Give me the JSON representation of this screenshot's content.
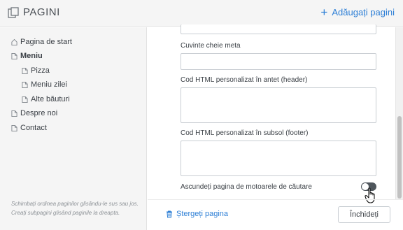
{
  "header": {
    "title": "PAGINI",
    "add_label": "Adăugați pagini",
    "icon": "pages-icon"
  },
  "sidebar": {
    "items": [
      {
        "label": "Pagina de start",
        "icon": "home-icon",
        "level": 0,
        "bold": false
      },
      {
        "label": "Meniu",
        "icon": "page-icon",
        "level": 0,
        "bold": true
      },
      {
        "label": "Pizza",
        "icon": "page-icon",
        "level": 1,
        "bold": false
      },
      {
        "label": "Meniu zilei",
        "icon": "page-icon",
        "level": 1,
        "bold": false
      },
      {
        "label": "Alte băuturi",
        "icon": "page-icon",
        "level": 1,
        "bold": false
      },
      {
        "label": "Despre noi",
        "icon": "page-icon",
        "level": 0,
        "bold": false
      },
      {
        "label": "Contact",
        "icon": "page-icon",
        "level": 0,
        "bold": false
      }
    ],
    "hint": "Schimbați ordinea paginilor glisându-le sus sau jos. Creați subpagini glisând paginile la dreapta."
  },
  "form": {
    "meta_keywords_label": "Cuvinte cheie meta",
    "header_html_label": "Cod HTML personalizat în antet (header)",
    "footer_html_label": "Cod HTML personalizat în subsol (footer)",
    "hide_search_label": "Ascundeți pagina de motoarele de căutare",
    "hide_search_on": false
  },
  "footer": {
    "delete_label": "Ștergeți pagina",
    "close_label": "Închideți"
  },
  "colors": {
    "accent": "#2d7fd6",
    "toggle": "#4f565c",
    "sidebar_bg": "#f5f5f5"
  }
}
